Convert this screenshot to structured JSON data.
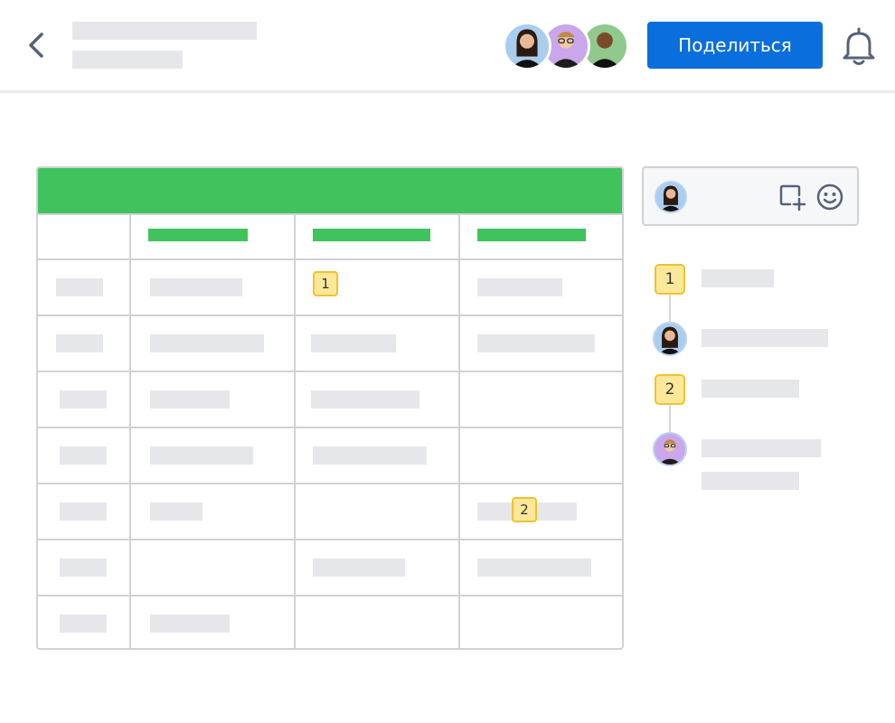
{
  "header": {
    "share_label": "Поделиться",
    "back_icon": "chevron-left-icon",
    "bell_icon": "bell-icon",
    "collaborators": [
      {
        "bg": "#a9cdef"
      },
      {
        "bg": "#c9a7ea"
      },
      {
        "bg": "#8fc98d"
      }
    ]
  },
  "sheet": {
    "header_color": "#40c25d",
    "markers": [
      "1",
      "2"
    ]
  },
  "comments": {
    "thread": [
      "1",
      "2"
    ],
    "add_comment_icon": "add-comment-icon",
    "emoji_icon": "emoji-icon"
  },
  "colors": {
    "accent": "#0a6fdc",
    "sheet_green": "#40c25d",
    "marker_fill": "#fde89a",
    "marker_border": "#f2c12e",
    "placeholder": "#e6e7eb"
  }
}
